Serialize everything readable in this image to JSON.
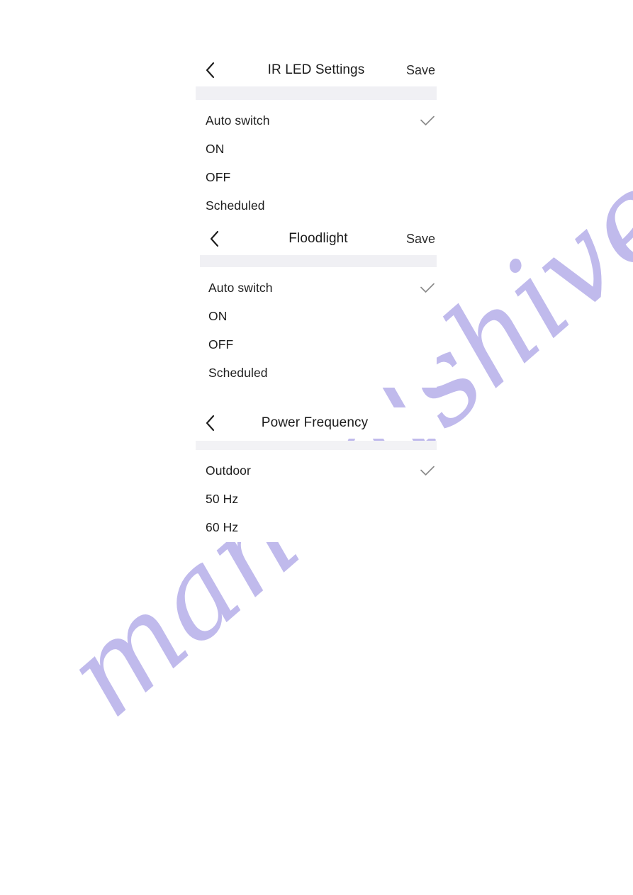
{
  "watermark": {
    "text": "manualshive.com",
    "color": "#bdb7ec"
  },
  "theme": {
    "background": "#ffffff",
    "divider": "#f0f0f4",
    "text_primary": "#1d1d1d",
    "check_color": "#8a8a8a"
  },
  "screens": [
    {
      "id": "ir-led-settings",
      "title": "IR LED Settings",
      "back_icon": "chevron-left-icon",
      "save_label": "Save",
      "has_save": true,
      "options": [
        {
          "label": "Auto switch",
          "selected": true
        },
        {
          "label": "ON",
          "selected": false
        },
        {
          "label": "OFF",
          "selected": false
        },
        {
          "label": "Scheduled",
          "selected": false
        }
      ]
    },
    {
      "id": "floodlight",
      "title": "Floodlight",
      "back_icon": "chevron-left-icon",
      "save_label": "Save",
      "has_save": true,
      "options": [
        {
          "label": "Auto switch",
          "selected": true
        },
        {
          "label": "ON",
          "selected": false
        },
        {
          "label": "OFF",
          "selected": false
        },
        {
          "label": "Scheduled",
          "selected": false
        }
      ]
    },
    {
      "id": "power-frequency",
      "title": "Power Frequency",
      "back_icon": "chevron-left-icon",
      "save_label": "",
      "has_save": false,
      "options": [
        {
          "label": "Outdoor",
          "selected": true
        },
        {
          "label": "50 Hz",
          "selected": false
        },
        {
          "label": "60 Hz",
          "selected": false
        }
      ]
    }
  ]
}
